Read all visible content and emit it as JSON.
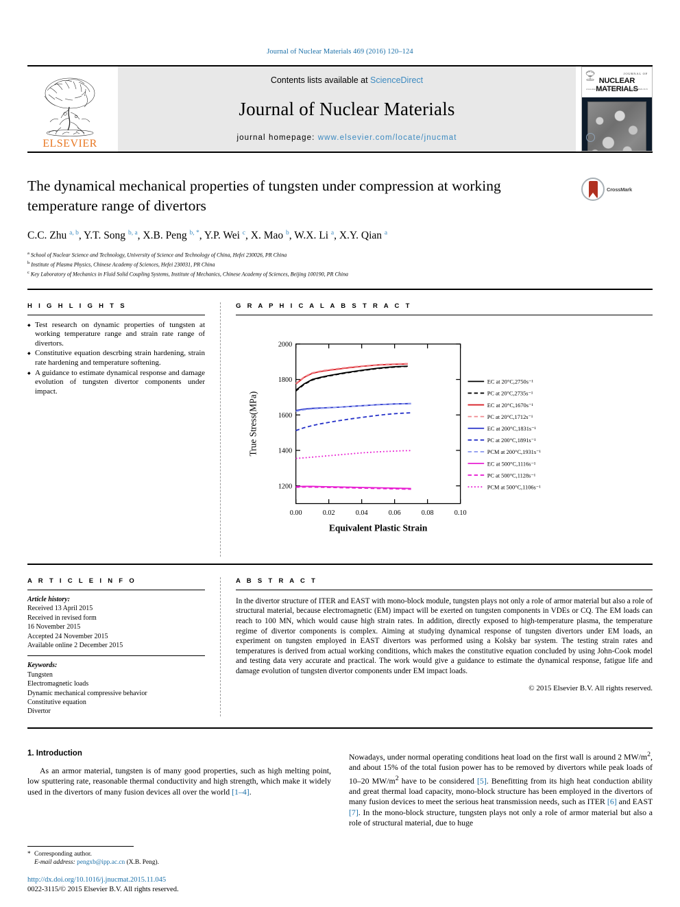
{
  "running_head": "Journal of Nuclear Materials 469 (2016) 120–124",
  "masthead": {
    "contents_prefix": "Contents lists available at ",
    "sciencedirect": "ScienceDirect",
    "journal_name": "Journal of Nuclear Materials",
    "homepage_prefix": "journal homepage: ",
    "homepage_url": "www.elsevier.com/locate/jnucmat",
    "publisher": "ELSEVIER",
    "cover": {
      "journal_of": "JOURNAL OF",
      "title": "NUCLEAR MATERIALS",
      "left_small": "www.elsevier.com",
      "right_small": "Volume 469  February 2016  ISSN 0022-3115"
    },
    "accent_link_color": "#3c8ac0",
    "elsevier_orange": "#E87722"
  },
  "crossmark": {
    "label": "CrossMark"
  },
  "title": "The dynamical mechanical properties of tungsten under compression at working temperature range of divertors",
  "authors_html": "C.C. Zhu <sup>a, b</sup>, Y.T. Song <sup>b, a</sup>, X.B. Peng <sup>b, *</sup>, Y.P. Wei <sup>c</sup>, X. Mao <sup>b</sup>, W.X. Li <sup>a</sup>, X.Y. Qian <sup>a</sup>",
  "affiliations": [
    {
      "marker": "a",
      "text": "School of Nuclear Science and Technology, University of Science and Technology of China, Hefei 230026, PR China"
    },
    {
      "marker": "b",
      "text": "Institute of Plasma Physics, Chinese Academy of Sciences, Hefei 230031, PR China"
    },
    {
      "marker": "c",
      "text": "Key Laboratory of Mechanics in Fluid Solid Coupling Systems, Institute of Mechanics, Chinese Academy of Sciences, Beijing 100190, PR China"
    }
  ],
  "highlights": {
    "heading": "H I G H L I G H T S",
    "items": [
      "Test research on dynamic properties of tungsten at working temperature range and strain rate range of divertors.",
      "Constitutive equation descrbing strain hardening, strain rate hardening and temperature softening.",
      "A guidance to estimate dynamical response and damage evolution of tungsten divertor components under impact."
    ]
  },
  "graphical_abstract": {
    "heading": "G R A P H I C A L   A B S T R A C T"
  },
  "chart_data": {
    "type": "line",
    "title": "",
    "xlabel": "Equivalent Plastic Strain",
    "ylabel": "True Stress(MPa)",
    "xlim": [
      0.0,
      0.1
    ],
    "ylim": [
      1100,
      2000
    ],
    "xticks": [
      "0.00",
      "0.02",
      "0.04",
      "0.06",
      "0.08",
      "0.10"
    ],
    "yticks": [
      "2000",
      "1800",
      "1600",
      "1400",
      "1200"
    ],
    "grid": false,
    "legend_position": "right",
    "series": [
      {
        "name": "EC at 20°C,2750s⁻¹",
        "color": "#000000",
        "dash": "solid",
        "x": [
          0.0,
          0.005,
          0.01,
          0.015,
          0.02,
          0.025,
          0.03,
          0.035,
          0.04,
          0.045,
          0.05,
          0.055,
          0.06,
          0.065,
          0.068
        ],
        "y": [
          1740,
          1775,
          1800,
          1812,
          1822,
          1830,
          1838,
          1845,
          1852,
          1858,
          1864,
          1868,
          1872,
          1874,
          1875
        ]
      },
      {
        "name": "PC at 20°C,2735s⁻¹",
        "color": "#000000",
        "dash": "dash",
        "x": [
          0.0,
          0.005,
          0.01,
          0.015,
          0.02,
          0.025,
          0.03,
          0.035,
          0.04,
          0.045,
          0.05,
          0.055,
          0.06,
          0.065,
          0.068
        ],
        "y": [
          1735,
          1772,
          1797,
          1810,
          1820,
          1828,
          1836,
          1843,
          1850,
          1856,
          1862,
          1866,
          1870,
          1873,
          1874
        ]
      },
      {
        "name": "EC at 20°C,1670s⁻¹",
        "color": "#d81f26",
        "dash": "solid",
        "x": [
          0.0,
          0.005,
          0.01,
          0.015,
          0.02,
          0.025,
          0.03,
          0.035,
          0.04,
          0.045,
          0.05,
          0.055,
          0.06,
          0.065,
          0.068
        ],
        "y": [
          1775,
          1812,
          1835,
          1845,
          1852,
          1858,
          1864,
          1869,
          1874,
          1878,
          1882,
          1884,
          1886,
          1887,
          1888
        ]
      },
      {
        "name": "PC at 20°C,1712s⁻¹",
        "color": "#f08a8f",
        "dash": "dash",
        "x": [
          0.0,
          0.005,
          0.01,
          0.015,
          0.02,
          0.025,
          0.03,
          0.035,
          0.04,
          0.045,
          0.05,
          0.055,
          0.06,
          0.065,
          0.068
        ],
        "y": [
          1778,
          1815,
          1838,
          1848,
          1855,
          1861,
          1867,
          1872,
          1876,
          1880,
          1884,
          1886,
          1888,
          1889,
          1890
        ]
      },
      {
        "name": "EC at 200°C,1831s⁻¹",
        "color": "#2733c9",
        "dash": "solid",
        "x": [
          0.0,
          0.005,
          0.01,
          0.015,
          0.02,
          0.025,
          0.03,
          0.035,
          0.04,
          0.045,
          0.05,
          0.055,
          0.06,
          0.065,
          0.07
        ],
        "y": [
          1625,
          1633,
          1637,
          1639,
          1641,
          1643,
          1646,
          1649,
          1652,
          1655,
          1658,
          1660,
          1662,
          1663,
          1664
        ]
      },
      {
        "name": "PC at 200°C,1891s⁻¹",
        "color": "#2733c9",
        "dash": "dash",
        "x": [
          0.0,
          0.005,
          0.01,
          0.015,
          0.02,
          0.025,
          0.03,
          0.035,
          0.04,
          0.045,
          0.05,
          0.055,
          0.06,
          0.065,
          0.07
        ],
        "y": [
          1512,
          1528,
          1540,
          1550,
          1558,
          1566,
          1573,
          1580,
          1586,
          1592,
          1598,
          1603,
          1607,
          1610,
          1612
        ]
      },
      {
        "name": "PCM at 200°C,1931s⁻¹",
        "color": "#8f9cf0",
        "dash": "dash",
        "x": [
          0.0,
          0.005,
          0.01,
          0.015,
          0.02,
          0.025,
          0.03,
          0.035,
          0.04,
          0.045,
          0.05,
          0.055,
          0.06,
          0.065,
          0.07
        ],
        "y": [
          1620,
          1629,
          1634,
          1637,
          1640,
          1643,
          1646,
          1649,
          1652,
          1655,
          1657,
          1659,
          1661,
          1662,
          1663
        ]
      },
      {
        "name": "EC at 500°C,1116s⁻¹",
        "color": "#e81fd2",
        "dash": "solid",
        "x": [
          0.0,
          0.005,
          0.01,
          0.015,
          0.02,
          0.025,
          0.03,
          0.035,
          0.04,
          0.045,
          0.05,
          0.055,
          0.06,
          0.065,
          0.07
        ],
        "y": [
          1196,
          1197,
          1197,
          1196,
          1195,
          1194,
          1193,
          1192,
          1191,
          1190,
          1189,
          1188,
          1187,
          1186,
          1185
        ]
      },
      {
        "name": "PC at 500°C,1128s⁻¹",
        "color": "#e81fd2",
        "dash": "dash",
        "x": [
          0.0,
          0.005,
          0.01,
          0.015,
          0.02,
          0.025,
          0.03,
          0.035,
          0.04,
          0.045,
          0.05,
          0.055,
          0.06,
          0.065,
          0.07
        ],
        "y": [
          1192,
          1193,
          1193,
          1192,
          1191,
          1190,
          1189,
          1188,
          1187,
          1186,
          1185,
          1184,
          1183,
          1182,
          1181
        ]
      },
      {
        "name": "PCM at 500°C,1106s⁻¹",
        "color": "#e81fd2",
        "dash": "dot",
        "x": [
          0.0,
          0.005,
          0.01,
          0.015,
          0.02,
          0.025,
          0.03,
          0.035,
          0.04,
          0.045,
          0.05,
          0.055,
          0.06,
          0.065,
          0.07
        ],
        "y": [
          1355,
          1358,
          1362,
          1366,
          1370,
          1374,
          1378,
          1382,
          1386,
          1389,
          1392,
          1394,
          1396,
          1398,
          1399
        ]
      }
    ]
  },
  "article_info": {
    "heading": "A R T I C L E   I N F O",
    "history_label": "Article history:",
    "history": [
      "Received 13 April 2015",
      "Received in revised form",
      "16 November 2015",
      "Accepted 24 November 2015",
      "Available online 2 December 2015"
    ],
    "keywords_label": "Keywords:",
    "keywords": [
      "Tungsten",
      "Electromagnetic loads",
      "Dynamic mechanical compressive behavior",
      "Constitutive equation",
      "Divertor"
    ]
  },
  "abstract": {
    "heading": "A B S T R A C T",
    "text": "In the divertor structure of ITER and EAST with mono-block module, tungsten plays not only a role of armor material but also a role of structural material, because electromagnetic (EM) impact will be exerted on tungsten components in VDEs or CQ. The EM loads can reach to 100 MN, which would cause high strain rates. In addition, directly exposed to high-temperature plasma, the temperature regime of divertor components is complex. Aiming at studying dynamical response of tungsten divertors under EM loads, an experiment on tungsten employed in EAST divertors was performed using a Kolsky bar system. The testing strain rates and temperatures is derived from actual working conditions, which makes the constitutive equation concluded by using John-Cook model and testing data very accurate and practical. The work would give a guidance to estimate the dynamical response, fatigue life and damage evolution of tungsten divertor components under EM impact loads.",
    "copyright": "© 2015 Elsevier B.V. All rights reserved."
  },
  "body": {
    "section_number_title": "1.  Introduction",
    "left_paragraph_part1": "As an armor material, tungsten is of many good properties, such as high melting point, low sputtering rate, reasonable thermal conductivity and high strength, which make it widely used in the divertors of many fusion devices all over the world ",
    "left_ref": "[1–4]",
    "left_paragraph_part2": ".",
    "right_p1": "Nowadays, under normal operating conditions heat load on the first wall is around 2 MW/m",
    "right_sup1": "2",
    "right_p2": ", and about 15% of the total fusion power has to be removed by divertors while peak loads of 10–20 MW/m",
    "right_sup2": "2",
    "right_p3": " have to be considered ",
    "right_ref1": "[5]",
    "right_p4": ". Benefitting from its high heat conduction ability and great thermal load capacity, mono-block structure has been employed in the divertors of many fusion devices to meet the serious heat transmission needs, such as ITER ",
    "right_ref2": "[6]",
    "right_p5": " and EAST ",
    "right_ref3": "[7]",
    "right_p6": ". In the mono-block structure, tungsten plays not only a role of armor material but also a role of structural material, due to huge"
  },
  "footnote": {
    "star": "*",
    "corresponding": "Corresponding author.",
    "email_label": "E-mail address:",
    "email": "pengxb@ipp.ac.cn",
    "email_owner": "(X.B. Peng)."
  },
  "doi": "http://dx.doi.org/10.1016/j.jnucmat.2015.11.045",
  "issn_line": "0022-3115/© 2015 Elsevier B.V. All rights reserved."
}
